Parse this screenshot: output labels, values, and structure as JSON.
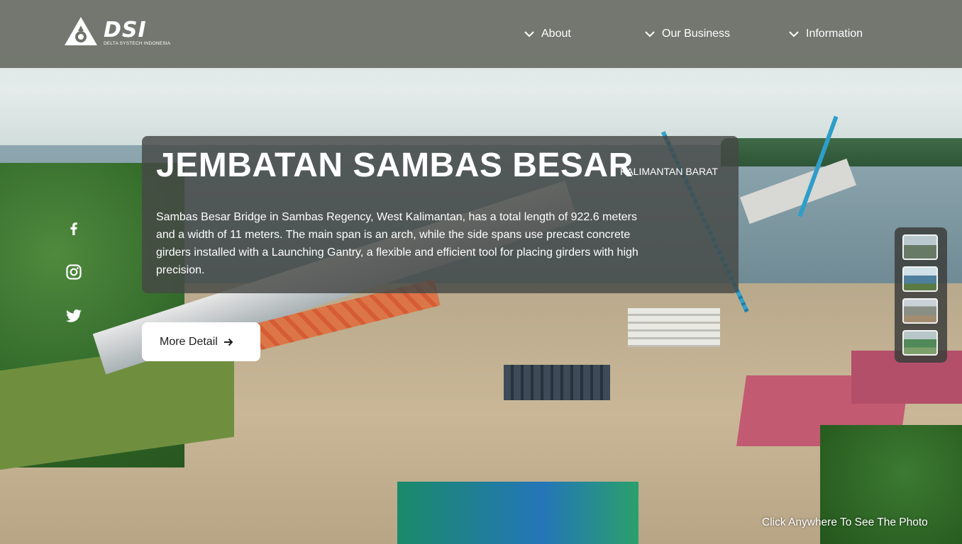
{
  "brand": {
    "logo_text": "DSI",
    "logo_subtitle": "DELTA SYSTECH INDONESIA"
  },
  "nav": {
    "items": [
      {
        "label": "About",
        "icon": "chevron-down-icon"
      },
      {
        "label": "Our Business",
        "icon": "chevron-down-icon"
      },
      {
        "label": "Information",
        "icon": "chevron-down-icon"
      }
    ]
  },
  "social": [
    "facebook-icon",
    "instagram-icon",
    "twitter-icon"
  ],
  "hero": {
    "title": "JEMBATAN SAMBAS BESAR",
    "location": "KALIMANTAN BARAT",
    "description": "Sambas Besar Bridge in Sambas Regency, West Kalimantan, has a total length of 922.6 meters and a width of 11 meters. The main span is an arch, while the side spans use precast concrete girders installed with a Launching Gantry, a flexible and efficient tool for placing girders with high precision.",
    "button_label": "More Detail"
  },
  "hint": "Click Anywhere To See The Photo",
  "colors": {
    "header_bg": "#6e726a",
    "card_bg": "#464846",
    "text": "#ffffff",
    "button_bg": "#ffffff"
  }
}
